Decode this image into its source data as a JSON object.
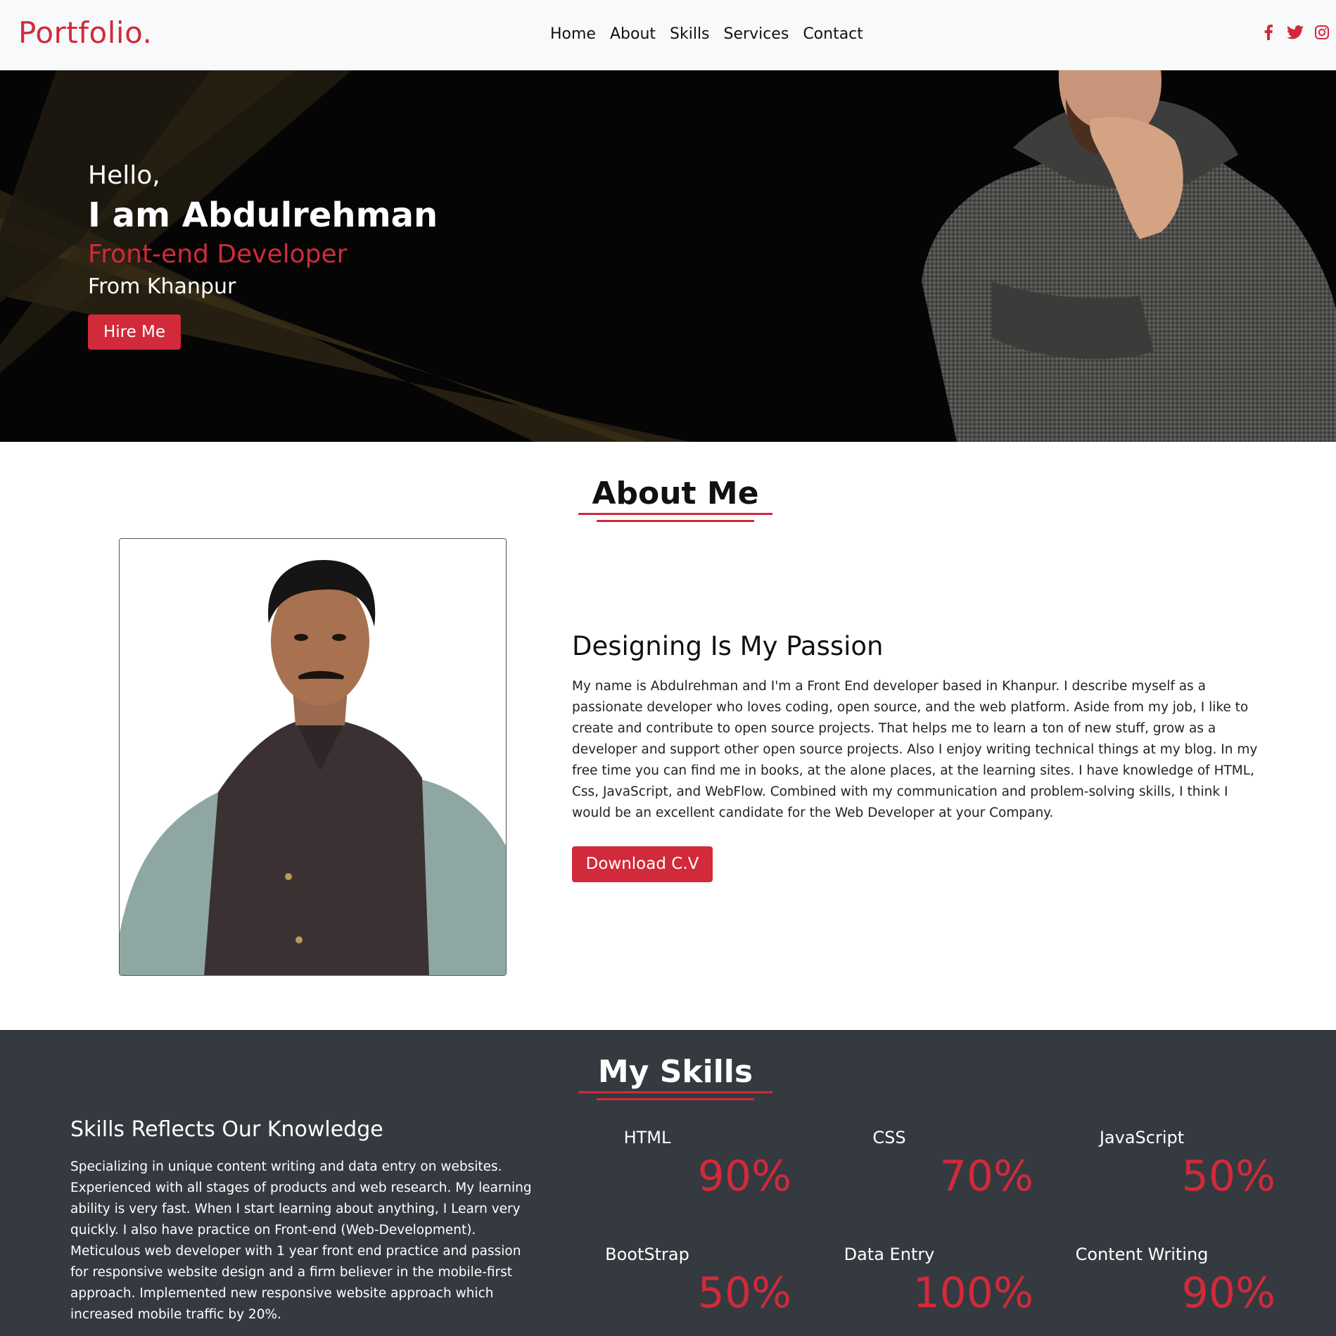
{
  "nav": {
    "brand": "Portfolio.",
    "links": [
      "Home",
      "About",
      "Skills",
      "Services",
      "Contact"
    ],
    "socials": [
      "facebook-icon",
      "twitter-icon",
      "instagram-icon"
    ],
    "accent": "#d12a3a"
  },
  "hero": {
    "hello": "Hello,",
    "name": "I am Abdulrehman",
    "role": "Front-end Developer",
    "from": "From Khanpur",
    "cta": "Hire Me"
  },
  "about": {
    "title": "About Me",
    "heading": "Designing Is My Passion",
    "body": "My name is Abdulrehman and I'm a Front End developer based in Khanpur. I describe myself as a passionate developer who loves coding, open source, and the web platform. Aside from my job, I like to create and contribute to open source projects. That helps me to learn a ton of new stuff, grow as a developer and support other open source projects. Also I enjoy writing technical things at my blog. In my free time you can find me in books, at the alone places, at the learning sites. I have knowledge of HTML, Css, JavaScript, and WebFlow. Combined with my communication and problem-solving skills, I think I would be an excellent candidate for the Web Developer at your Company.",
    "cta": "Download C.V"
  },
  "skills": {
    "title": "My Skills",
    "heading": "Skills Reflects Our Knowledge",
    "body": "Specializing in unique content writing and data entry on websites. Experienced with all stages of products and web research. My learning ability is very fast. When I start learning about anything, I Learn very quickly. I also have practice on Front-end (Web-Development). Meticulous web developer with 1 year front end practice and passion for responsive website design and a firm believer in the mobile-first approach. Implemented new responsive website approach which increased mobile traffic by 20%.",
    "items": [
      {
        "name": "HTML",
        "percent": "90%"
      },
      {
        "name": "CSS",
        "percent": "70%"
      },
      {
        "name": "JavaScript",
        "percent": "50%"
      },
      {
        "name": "BootStrap",
        "percent": "50%"
      },
      {
        "name": "Data Entry",
        "percent": "100%"
      },
      {
        "name": "Content Writing",
        "percent": "90%"
      }
    ]
  }
}
